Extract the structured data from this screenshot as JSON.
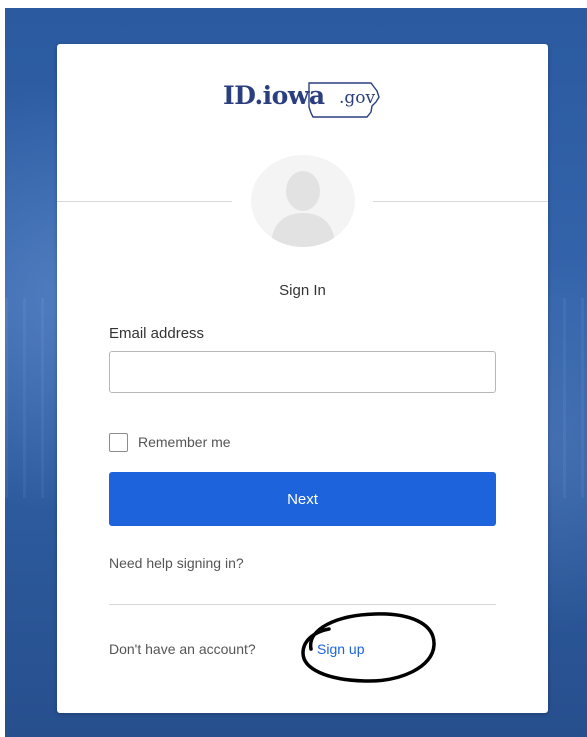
{
  "logo": {
    "main": "ID.iowa",
    "suffix": ".gov"
  },
  "form": {
    "title": "Sign In",
    "email_label": "Email address",
    "email_value": "",
    "email_placeholder": "",
    "remember_label": "Remember me",
    "remember_checked": false,
    "next_label": "Next",
    "help_link": "Need help signing in?",
    "no_account_text": "Don't have an account?",
    "signup_link": "Sign up"
  },
  "colors": {
    "brand_blue": "#1d63dc",
    "logo_navy": "#2a3f7e",
    "annotation": "#000000"
  },
  "icons": {
    "avatar": "user-silhouette-icon"
  }
}
